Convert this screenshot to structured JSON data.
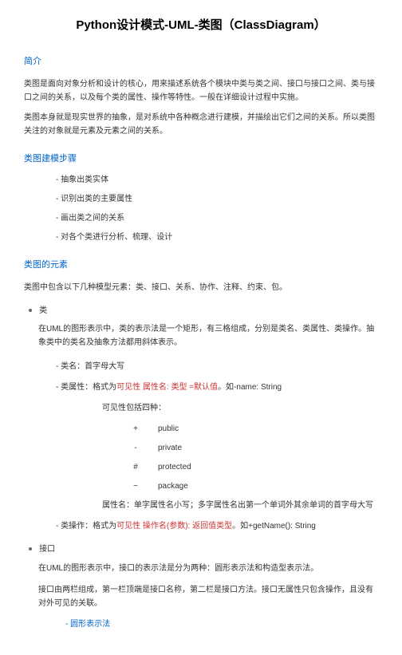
{
  "title": "Python设计模式-UML-类图（ClassDiagram）",
  "intro": {
    "heading": "简介",
    "p1": "类图是面向对象分析和设计的核心，用来描述系统各个模块中类与类之间、接口与接口之间、类与接口之间的关系，以及每个类的属性、操作等特性。一般在详细设计过程中实施。",
    "p2": "类图本身就是现实世界的抽象，是对系统中各种概念进行建模，并描绘出它们之间的关系。所以类图关注的对象就是元素及元素之间的关系。"
  },
  "steps": {
    "heading": "类图建模步骤",
    "items": [
      "抽象出类实体",
      "识别出类的主要属性",
      "画出类之间的关系",
      "对各个类进行分析、梳理、设计"
    ]
  },
  "elements": {
    "heading": "类图的元素",
    "p1": "类图中包含以下几种模型元素：类、接口、关系、协作、注释、约束、包。"
  },
  "class_sec": {
    "bullet": "类",
    "p1": "在UML的图形表示中，类的表示法是一个矩形，有三格组成，分别是类名、类属性、类操作。抽象类中的类名及抽象方法都用斜体表示。",
    "name_item": "- 类名：首字母大写",
    "attr_prefix": "- 类属性：格式为",
    "attr_red": "可见性 属性名: 类型 =默认值",
    "attr_suffix": "。如-name: String",
    "vis_intro": "可见性包括四种：",
    "vis": [
      {
        "sym": "+",
        "name": "public"
      },
      {
        "sym": "-",
        "name": "private"
      },
      {
        "sym": "#",
        "name": "protected"
      },
      {
        "sym": "~",
        "name": "package"
      }
    ],
    "attr_name_rule": "属性名：单字属性名小写；多字属性名出第一个单词外其余单词的首字母大写",
    "op_prefix": "- 类操作：格式为",
    "op_red": "可见性 操作名(参数):  返回值类型",
    "op_suffix": "。如+getName(): String"
  },
  "iface_sec": {
    "bullet": "接口",
    "p1": "在UML的图形表示中，接口的表示法是分为两种：圆形表示法和构造型表示法。",
    "p2": "接口由两栏组成，第一栏顶端是接口名称，第二栏是接口方法。接口无属性只包含操作，且没有对外可见的关联。",
    "link": "- 圆形表示法"
  }
}
